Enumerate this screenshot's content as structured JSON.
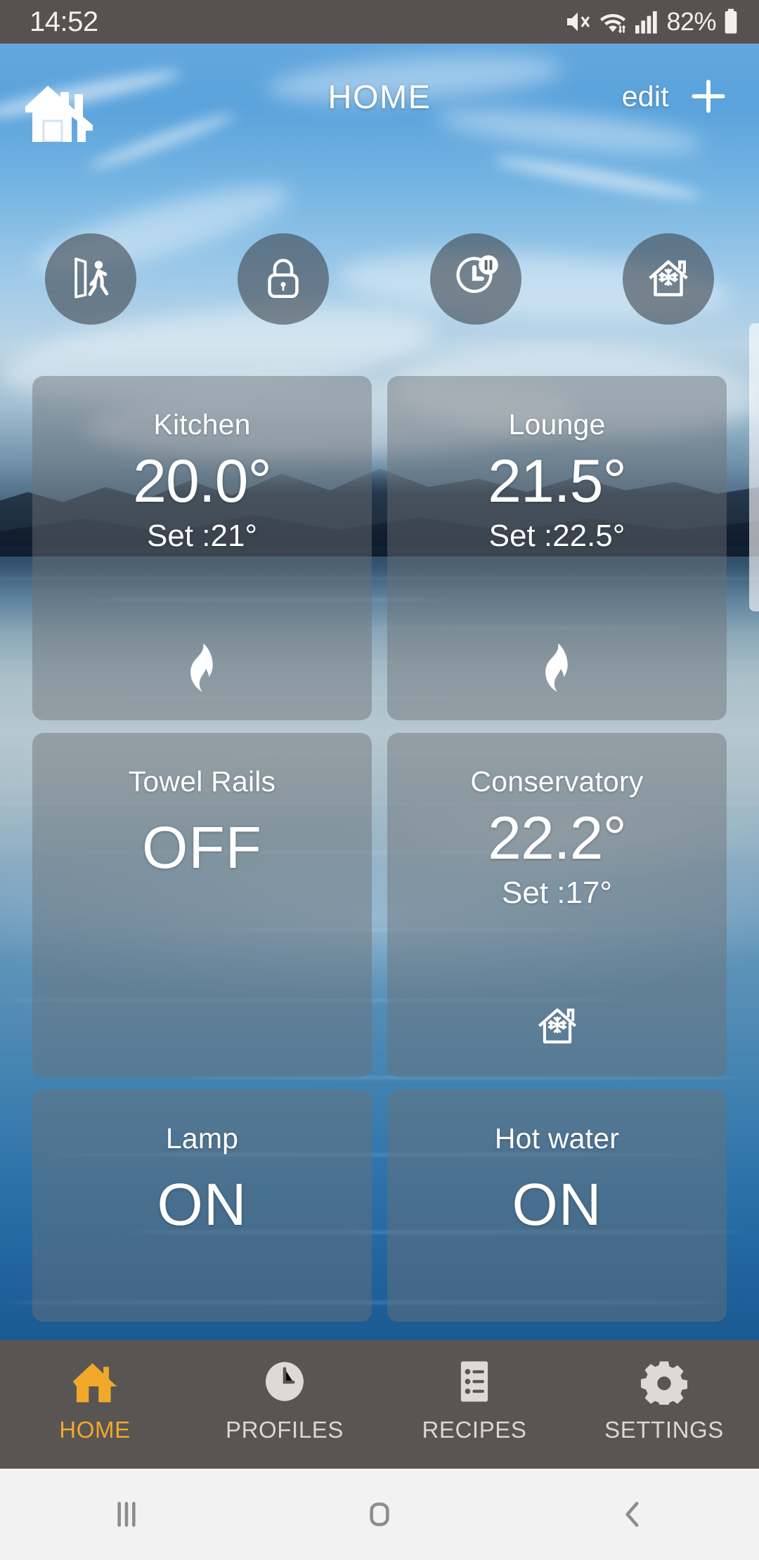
{
  "status_bar": {
    "time": "14:52",
    "battery_percent": "82%",
    "icons": [
      "mute-icon",
      "wifi-icon",
      "signal-icon",
      "battery-icon"
    ]
  },
  "header": {
    "logo_icon": "house-logo-icon",
    "title": "HOME",
    "edit_label": "edit",
    "add_icon": "plus-icon"
  },
  "quick_actions": [
    {
      "name": "away",
      "icon": "person-exiting-door-icon"
    },
    {
      "name": "lock",
      "icon": "padlock-icon"
    },
    {
      "name": "hold",
      "icon": "clock-pause-icon"
    },
    {
      "name": "frost",
      "icon": "house-snowflake-icon"
    }
  ],
  "rooms": [
    {
      "title": "Kitchen",
      "value": "20.0°",
      "setpoint": "Set :21°",
      "icon": "flame-icon",
      "size": "large"
    },
    {
      "title": "Lounge",
      "value": "21.5°",
      "setpoint": "Set :22.5°",
      "icon": "flame-icon",
      "size": "large"
    },
    {
      "title": "Towel Rails",
      "value": "OFF",
      "setpoint": "",
      "icon": "",
      "size": "large"
    },
    {
      "title": "Conservatory",
      "value": "22.2°",
      "setpoint": "Set :17°",
      "icon": "house-snowflake-icon",
      "size": "large"
    },
    {
      "title": "Lamp",
      "value": "ON",
      "setpoint": "",
      "icon": "",
      "size": "small"
    },
    {
      "title": "Hot water",
      "value": "ON",
      "setpoint": "",
      "icon": "",
      "size": "small"
    }
  ],
  "tabs": [
    {
      "label": "HOME",
      "icon": "house-icon",
      "active": true
    },
    {
      "label": "PROFILES",
      "icon": "clock-icon",
      "active": false
    },
    {
      "label": "RECIPES",
      "icon": "list-icon",
      "active": false
    },
    {
      "label": "SETTINGS",
      "icon": "gear-icon",
      "active": false
    }
  ],
  "system_nav": [
    {
      "name": "recents",
      "icon": "recents-icon"
    },
    {
      "name": "home",
      "icon": "home-square-icon"
    },
    {
      "name": "back",
      "icon": "back-chevron-icon"
    }
  ],
  "colors": {
    "accent": "#F0A92A",
    "status_bar_bg": "#575250",
    "tab_bar_bg": "#595553",
    "card_bg": "rgba(108,113,116,0.47)",
    "nav_bar_bg": "#f2f2f2"
  }
}
